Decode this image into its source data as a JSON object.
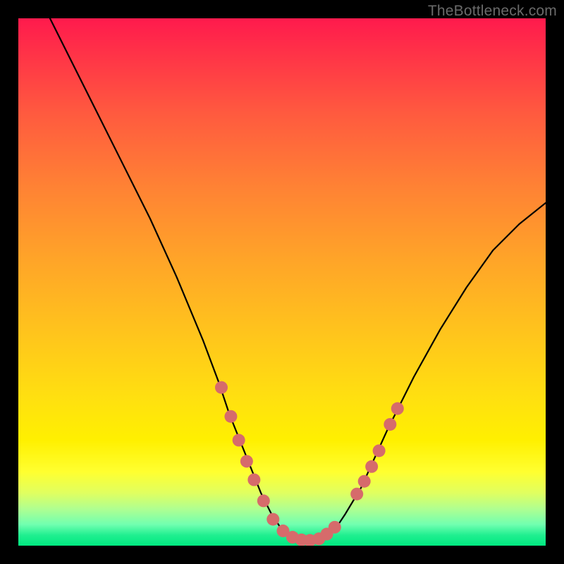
{
  "watermark": "TheBottleneck.com",
  "chart_data": {
    "type": "line",
    "title": "",
    "xlabel": "",
    "ylabel": "",
    "xlim": [
      0,
      100
    ],
    "ylim": [
      0,
      100
    ],
    "series": [
      {
        "name": "curve",
        "x": [
          6,
          10,
          15,
          20,
          25,
          30,
          35,
          38,
          40,
          42,
          44,
          46,
          48,
          50,
          52,
          54,
          56,
          58,
          60,
          62,
          65,
          70,
          75,
          80,
          85,
          90,
          95,
          100
        ],
        "y": [
          100,
          92,
          82,
          72,
          62,
          51,
          39,
          31,
          25,
          20,
          15,
          10,
          6,
          3,
          1.5,
          1,
          1,
          1.5,
          3,
          6,
          11,
          22,
          32,
          41,
          49,
          56,
          61,
          65
        ]
      }
    ],
    "markers": [
      {
        "x": 38.5,
        "y": 30.0
      },
      {
        "x": 40.3,
        "y": 24.5
      },
      {
        "x": 41.8,
        "y": 20.0
      },
      {
        "x": 43.3,
        "y": 16.0
      },
      {
        "x": 44.7,
        "y": 12.5
      },
      {
        "x": 46.5,
        "y": 8.5
      },
      {
        "x": 48.3,
        "y": 5.0
      },
      {
        "x": 50.2,
        "y": 2.8
      },
      {
        "x": 52.0,
        "y": 1.6
      },
      {
        "x": 53.7,
        "y": 1.1
      },
      {
        "x": 55.3,
        "y": 1.0
      },
      {
        "x": 57.0,
        "y": 1.3
      },
      {
        "x": 58.5,
        "y": 2.2
      },
      {
        "x": 60.0,
        "y": 3.5
      },
      {
        "x": 64.2,
        "y": 9.8
      },
      {
        "x": 65.6,
        "y": 12.2
      },
      {
        "x": 67.0,
        "y": 15.0
      },
      {
        "x": 68.4,
        "y": 18.0
      },
      {
        "x": 70.5,
        "y": 23.0
      },
      {
        "x": 71.9,
        "y": 26.0
      }
    ],
    "marker_color": "#d66b6b",
    "marker_radius": 9
  }
}
